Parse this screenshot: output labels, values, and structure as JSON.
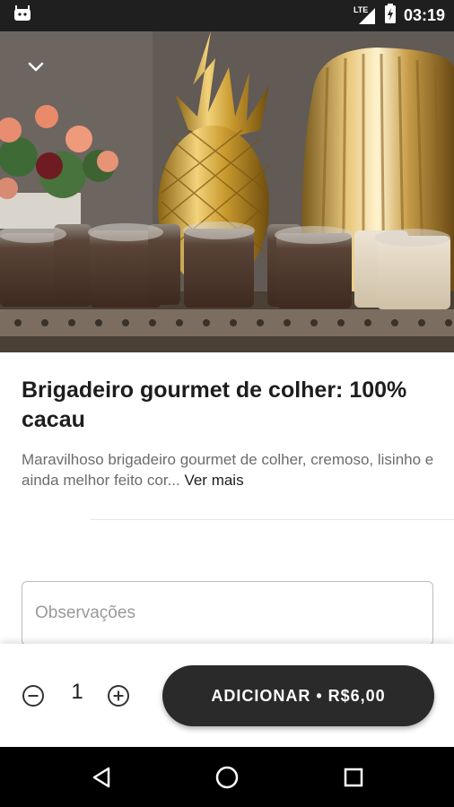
{
  "status_bar": {
    "time": "03:19",
    "network": "LTE"
  },
  "product": {
    "title": "Brigadeiro gourmet de colher: 100% cacau",
    "description": "Maravilhoso brigadeiro gourmet de colher, cremoso, lisinho e ainda melhor feito cor...",
    "see_more": "Ver mais"
  },
  "notes": {
    "placeholder": "Observações"
  },
  "order": {
    "quantity": "1",
    "add_label": "ADICIONAR • R$6,00"
  },
  "colors": {
    "button": "#2a2a2a",
    "status_bar": "#1f1f1f",
    "nav_bar": "#000000"
  }
}
